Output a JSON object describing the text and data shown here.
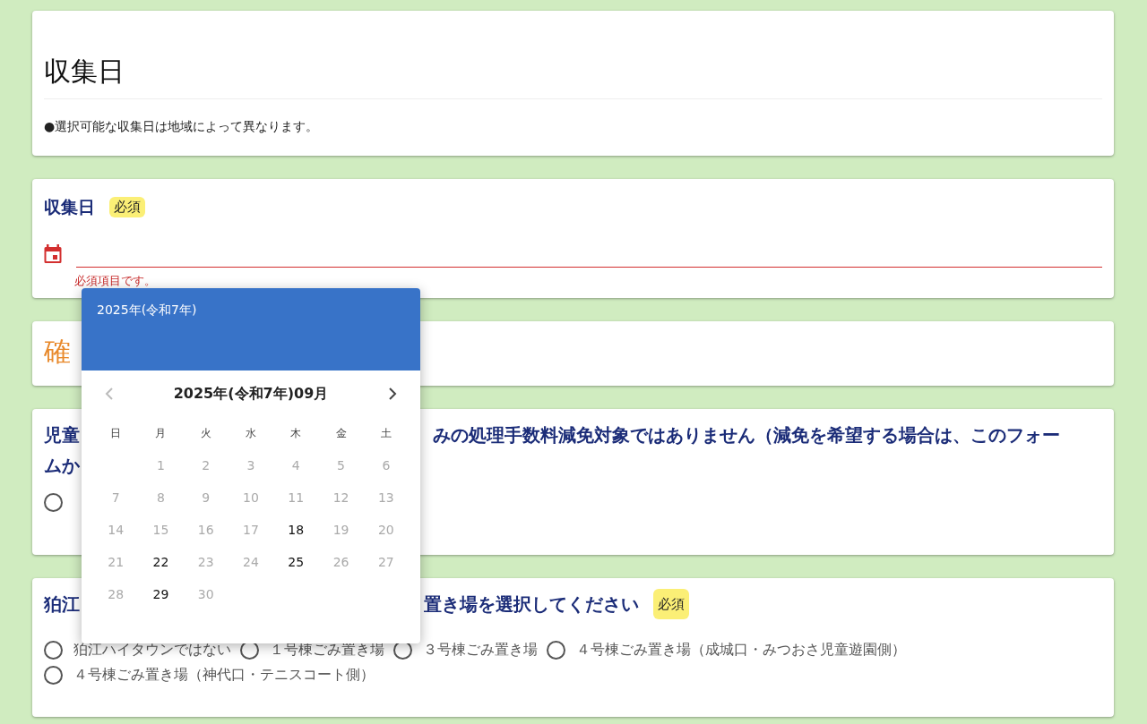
{
  "sections": [
    {
      "kind": "intro",
      "title": "収集日",
      "note": "●選択可能な収集日は地域によって異なります。"
    },
    {
      "kind": "date",
      "label": "収集日",
      "required_badge": "必須",
      "invalid": true,
      "error": "必須項目です。"
    },
    {
      "kind": "heading",
      "title": "確"
    },
    {
      "kind": "radio",
      "heading_lines": [
        {
          "left": "児童",
          "right": "みの処理手数料減免対象ではありません（減免を希望する場合は、このフォー"
        },
        {
          "left": "ムか"
        }
      ],
      "options": [
        {
          "selected": false
        }
      ]
    },
    {
      "kind": "radio",
      "heading_lines": [
        {
          "left": "狛江",
          "right": "置き場を選択してください"
        }
      ],
      "required_badge": "必須",
      "options": [
        {
          "label": "狛江ハイタウンではない",
          "selected": false
        },
        {
          "label": "１号棟ごみ置き場",
          "selected": false
        },
        {
          "label": "３号棟ごみ置き場",
          "selected": false
        },
        {
          "label": "４号棟ごみ置き場（成城口・みつおさ児童遊園側）",
          "selected": false
        },
        {
          "label": "４号棟ごみ置き場（神代口・テニスコート側）",
          "selected": false
        }
      ]
    }
  ],
  "datepicker": {
    "year_header": "2025年(令和7年)",
    "month_title": "2025年(令和7年)09月",
    "prev_disabled": true,
    "next_disabled": false,
    "weekdays": [
      "日",
      "月",
      "火",
      "水",
      "木",
      "金",
      "土"
    ],
    "weeks": [
      [
        {
          "label": "1",
          "enabled": false
        },
        {
          "label": "2",
          "enabled": false
        },
        {
          "label": "3",
          "enabled": false
        },
        {
          "label": "4",
          "enabled": false
        },
        {
          "label": "5",
          "enabled": false
        },
        {
          "label": "6",
          "enabled": false
        }
      ],
      [
        {
          "label": "7",
          "enabled": false
        },
        {
          "label": "8",
          "enabled": false
        },
        {
          "label": "9",
          "enabled": false
        },
        {
          "label": "10",
          "enabled": false
        },
        {
          "label": "11",
          "enabled": false
        },
        {
          "label": "12",
          "enabled": false
        },
        {
          "label": "13",
          "enabled": false
        }
      ],
      [
        {
          "label": "14",
          "enabled": false
        },
        {
          "label": "15",
          "enabled": false
        },
        {
          "label": "16",
          "enabled": false
        },
        {
          "label": "17",
          "enabled": false
        },
        {
          "label": "18",
          "enabled": true
        },
        {
          "label": "19",
          "enabled": false
        },
        {
          "label": "20",
          "enabled": false
        }
      ],
      [
        {
          "label": "21",
          "enabled": false
        },
        {
          "label": "22",
          "enabled": true
        },
        {
          "label": "23",
          "enabled": false
        },
        {
          "label": "24",
          "enabled": false
        },
        {
          "label": "25",
          "enabled": true
        },
        {
          "label": "26",
          "enabled": false
        },
        {
          "label": "27",
          "enabled": false
        }
      ],
      [
        {
          "label": "28",
          "enabled": false
        },
        {
          "label": "29",
          "enabled": true
        },
        {
          "label": "30",
          "enabled": false
        }
      ]
    ]
  }
}
